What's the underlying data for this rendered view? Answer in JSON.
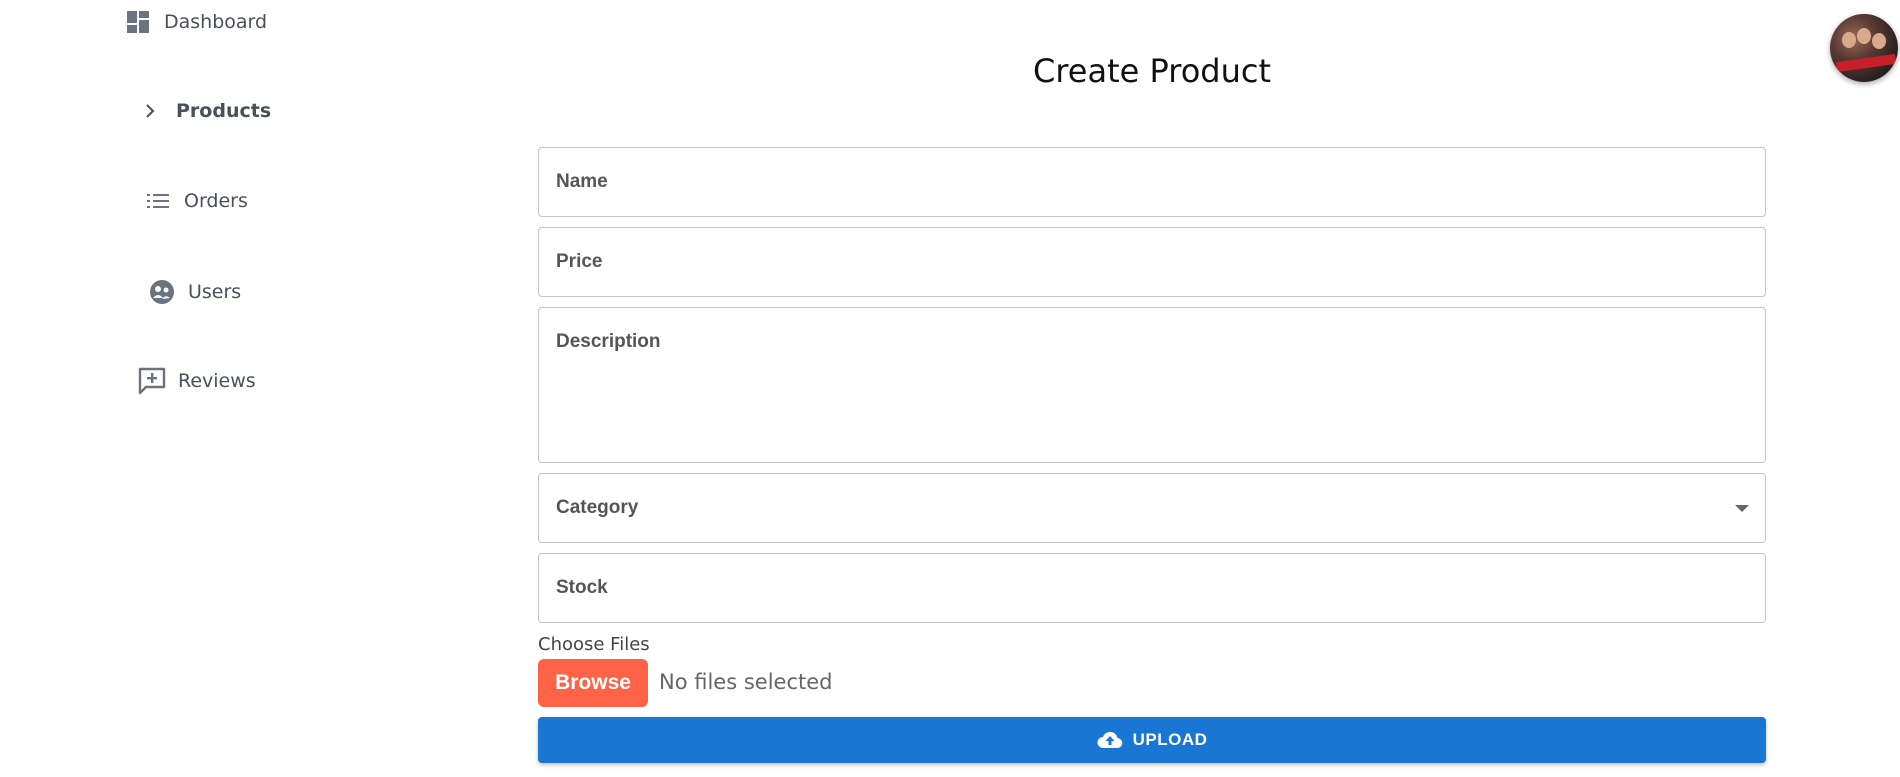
{
  "sidebar": {
    "items": [
      {
        "label": "Dashboard",
        "icon": "dashboard-icon"
      },
      {
        "label": "Products",
        "icon": "chevron-right-icon"
      },
      {
        "label": "Orders",
        "icon": "list-icon"
      },
      {
        "label": "Users",
        "icon": "users-icon"
      },
      {
        "label": "Reviews",
        "icon": "add-comment-icon"
      }
    ]
  },
  "header": {
    "avatar": "user-avatar"
  },
  "form": {
    "title": "Create Product",
    "fields": {
      "name": {
        "label": "Name"
      },
      "price": {
        "label": "Price"
      },
      "description": {
        "label": "Description"
      },
      "category": {
        "label": "Category",
        "icon": "dropdown-caret-icon"
      },
      "stock": {
        "label": "Stock"
      }
    },
    "files": {
      "label": "Choose Files",
      "browse_label": "Browse",
      "status": "No files selected"
    },
    "upload": {
      "label": "UPLOAD",
      "icon": "cloud-upload-icon"
    }
  },
  "colors": {
    "primary": "#1976d2",
    "browse": "#ff6347",
    "sidebar_text": "#4a4f5a",
    "border": "#c4c4c4"
  }
}
